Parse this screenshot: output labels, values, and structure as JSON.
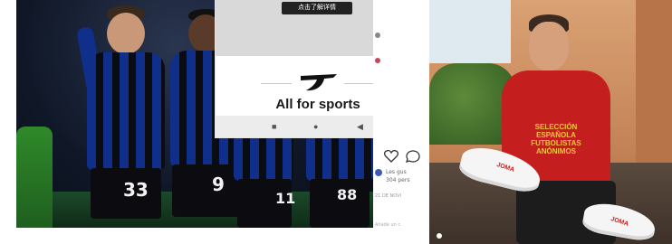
{
  "phone": {
    "top_button_label": "点击了解详情",
    "tagline": "All for sports",
    "nav": {
      "square": "■",
      "circle": "●",
      "back": "◀"
    }
  },
  "left_photo": {
    "jersey_numbers": [
      "33",
      "9",
      "11",
      "88"
    ]
  },
  "instagram": {
    "icons": [
      "heart-icon",
      "comment-icon"
    ],
    "liked_by_text": "Les gus",
    "likes_text": "304 pers",
    "time_text": "21 DE NOVI",
    "comment_prompt": "Añade un c"
  },
  "right_photo": {
    "shirt_text_lines": [
      "SELECCIÓN",
      "ESPAÑOLA",
      "FUTBOLISTAS",
      "ANÓNIMOS"
    ],
    "shoe_brand": "JOMA"
  },
  "colors": {
    "atalanta_blue": "#0f2f8a",
    "shirt_red": "#c41e1e",
    "shirt_text": "#f3c341",
    "joma_red": "#d21b1b"
  }
}
